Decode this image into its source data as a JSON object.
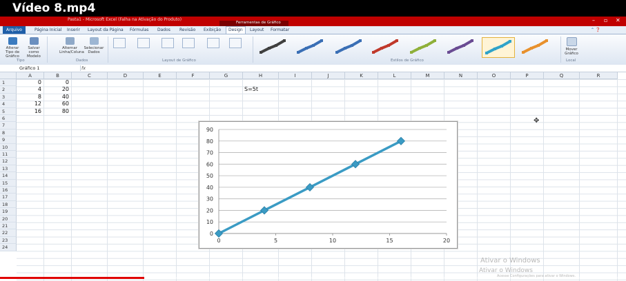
{
  "video": {
    "title": "Vídeo 8.mp4",
    "progress_percent": 23
  },
  "window": {
    "title": "Pasta1 - Microsoft Excel (Falha na Ativação do Produto)",
    "chart_tools_label": "Ferramentas de Gráfico",
    "controls": [
      "–",
      "▫",
      "✕"
    ]
  },
  "tabs": [
    "Arquivo",
    "Página Inicial",
    "Inserir",
    "Layout da Página",
    "Fórmulas",
    "Dados",
    "Revisão",
    "Exibição",
    "Design",
    "Layout",
    "Formatar"
  ],
  "active_tab": "Design",
  "ribbon": {
    "buttons": [
      {
        "label": "Alterar Tipo de Gráfico",
        "icon": "chart-type-icon"
      },
      {
        "label": "Salvar como Modelo",
        "icon": "save-template-icon"
      },
      {
        "label": "Alternar Linha/Coluna",
        "icon": "switch-row-column-icon"
      },
      {
        "label": "Selecionar Dados",
        "icon": "select-data-icon"
      }
    ],
    "groups": [
      "Tipo",
      "Dados",
      "Layout de Gráfico",
      "Estilos de Gráfico",
      "Local"
    ],
    "move_chart_label": "Mover Gráfico",
    "style_colors": [
      "#404040",
      "#3a6fb5",
      "#3a6fb5",
      "#c0392b",
      "#8fb03a",
      "#6a4c93",
      "#2fa3c9",
      "#e8912d"
    ]
  },
  "formula_bar": {
    "name_box": "Gráfico 1",
    "fx": "fx",
    "formula": ""
  },
  "columns": [
    "A",
    "B",
    "C",
    "D",
    "E",
    "F",
    "G",
    "H",
    "I",
    "J",
    "K",
    "L",
    "M",
    "N",
    "O",
    "P",
    "Q",
    "R"
  ],
  "rows": [
    "1",
    "2",
    "3",
    "4",
    "5",
    "6",
    "7",
    "8",
    "9",
    "10",
    "11",
    "12",
    "13",
    "14",
    "15",
    "16",
    "17",
    "18",
    "19",
    "20",
    "21",
    "22",
    "23",
    "24"
  ],
  "cells": {
    "A1": "0",
    "B1": "0",
    "A2": "4",
    "B2": "20",
    "A3": "8",
    "B3": "40",
    "A4": "12",
    "B4": "60",
    "A5": "16",
    "B5": "80",
    "H2": "S=5t"
  },
  "chart_data": {
    "type": "line",
    "x": [
      0,
      4,
      8,
      12,
      16
    ],
    "series": [
      {
        "values": [
          0,
          20,
          40,
          60,
          80
        ],
        "color": "#3a9bc4"
      }
    ],
    "xlim": [
      0,
      20
    ],
    "ylim": [
      0,
      90
    ],
    "x_ticks": [
      "0",
      "5",
      "10",
      "15",
      "20"
    ],
    "y_ticks": [
      "0",
      "10",
      "20",
      "30",
      "40",
      "50",
      "60",
      "70",
      "80",
      "90"
    ],
    "grid": true,
    "title": "",
    "xlabel": "",
    "ylabel": ""
  },
  "watermark": {
    "line1": "Ativar o Windows",
    "line2": "Ativar o Windows",
    "line3": "Acesse Configurações para ativar o Windows."
  }
}
